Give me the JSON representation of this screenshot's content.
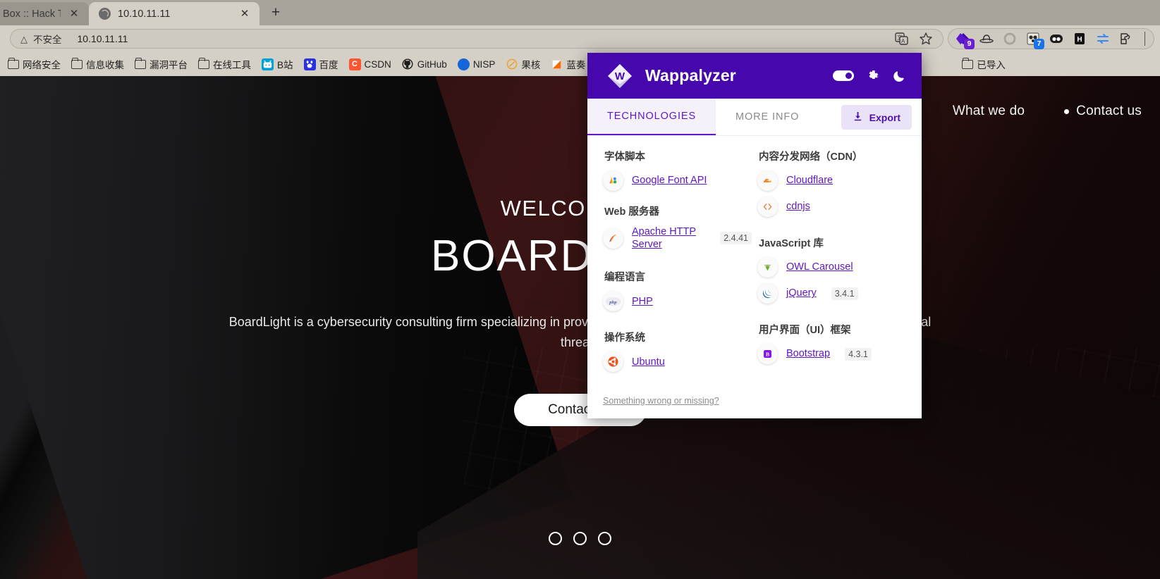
{
  "browser": {
    "tabs": [
      {
        "title": "Box :: Hack The",
        "favicon": "none",
        "active": false
      },
      {
        "title": "10.10.11.11",
        "favicon": "globe-icon",
        "active": true
      }
    ],
    "new_tab_label": "+",
    "omnibox": {
      "security_icon": "warning-triangle-icon",
      "security_label": "不安全",
      "url": "10.10.11.11",
      "right_icons": [
        "translate-icon",
        "bookmark-star-icon"
      ]
    },
    "extensions": [
      {
        "name": "wappalyzer-extension-icon",
        "badge": "9",
        "badge_color": "#6a1fd0"
      },
      {
        "name": "hat-extension-icon",
        "badge": ""
      },
      {
        "name": "circle-extension-icon",
        "badge": ""
      },
      {
        "name": "panda-extension-icon",
        "badge": "7",
        "badge_color": "#1a73e8"
      },
      {
        "name": "glasses-extension-icon",
        "badge": ""
      },
      {
        "name": "hackbar-extension-icon",
        "badge": ""
      },
      {
        "name": "proxy-switch-extension-icon",
        "badge": ""
      },
      {
        "name": "puzzle-extensions-icon",
        "badge": ""
      }
    ],
    "bookmarks": [
      {
        "label": "网络安全",
        "icon": "folder-icon"
      },
      {
        "label": "信息收集",
        "icon": "folder-icon"
      },
      {
        "label": "漏洞平台",
        "icon": "folder-icon"
      },
      {
        "label": "在线工具",
        "icon": "folder-icon"
      },
      {
        "label": "B站",
        "icon": "bilibili-icon",
        "color": "#00a1d6",
        "glyph": "□"
      },
      {
        "label": "百度",
        "icon": "baidu-icon",
        "color": "#2932e1",
        "glyph": "熊"
      },
      {
        "label": "CSDN",
        "icon": "csdn-icon",
        "color": "#fc5531",
        "glyph": "C"
      },
      {
        "label": "GitHub",
        "icon": "github-icon",
        "color": "#24292e",
        "glyph": "●"
      },
      {
        "label": "NISP",
        "icon": "nisp-icon",
        "color": "#1565d8",
        "glyph": "●"
      },
      {
        "label": "果核",
        "icon": "guohe-icon",
        "color": "#f0a030",
        "glyph": "●"
      },
      {
        "label": "蓝奏",
        "icon": "lanzou-icon",
        "color": "#ff6a00",
        "glyph": "◢"
      },
      {
        "label": "已导入",
        "icon": "folder-icon"
      }
    ]
  },
  "webpage": {
    "nav": [
      {
        "label": "What we do",
        "bullet": false
      },
      {
        "label": "Contact us",
        "bullet": true
      }
    ],
    "welcome": "WELCOME TO",
    "title": "BOARDLIGHT",
    "lede": "BoardLight is a cybersecurity consulting firm specializing in providing cutting-edge solutions to protect businesses from digital threats",
    "cta_label": "Contact us",
    "carousel_dots": 3
  },
  "wappalyzer": {
    "app_name": "Wappalyzer",
    "logo_icon": "wappalyzer-diamond-icon",
    "header_controls": [
      {
        "name": "power-toggle",
        "type": "toggle",
        "on": true
      },
      {
        "name": "gear-icon",
        "type": "icon"
      },
      {
        "name": "moon-icon",
        "type": "icon"
      }
    ],
    "tabs": [
      {
        "label": "TECHNOLOGIES",
        "selected": true
      },
      {
        "label": "MORE INFO",
        "selected": false
      }
    ],
    "export_label": "Export",
    "export_icon": "download-icon",
    "accent_color": "#4608ad",
    "link_color": "#5d16c4",
    "footer_link": "Something wrong or missing?",
    "columns": [
      {
        "categories": [
          {
            "name": "字体脚本",
            "technologies": [
              {
                "name": "Google Font API",
                "version": "",
                "icon": "google-font-api-icon"
              }
            ]
          },
          {
            "name": "Web 服务器",
            "technologies": [
              {
                "name": "Apache HTTP Server",
                "version": "2.4.41",
                "icon": "apache-feather-icon"
              }
            ]
          },
          {
            "name": "编程语言",
            "technologies": [
              {
                "name": "PHP",
                "version": "",
                "icon": "php-icon"
              }
            ]
          },
          {
            "name": "操作系统",
            "technologies": [
              {
                "name": "Ubuntu",
                "version": "",
                "icon": "ubuntu-icon"
              }
            ]
          }
        ]
      },
      {
        "categories": [
          {
            "name": "内容分发网络（CDN）",
            "technologies": [
              {
                "name": "Cloudflare",
                "version": "",
                "icon": "cloudflare-icon"
              },
              {
                "name": "cdnjs",
                "version": "",
                "icon": "cdnjs-icon"
              }
            ]
          },
          {
            "name": "JavaScript 库",
            "technologies": [
              {
                "name": "OWL Carousel",
                "version": "",
                "icon": "owl-carousel-icon"
              },
              {
                "name": "jQuery",
                "version": "3.4.1",
                "icon": "jquery-icon"
              }
            ]
          },
          {
            "name": "用户界面（UI）框架",
            "technologies": [
              {
                "name": "Bootstrap",
                "version": "4.3.1",
                "icon": "bootstrap-icon"
              }
            ]
          }
        ]
      }
    ]
  }
}
